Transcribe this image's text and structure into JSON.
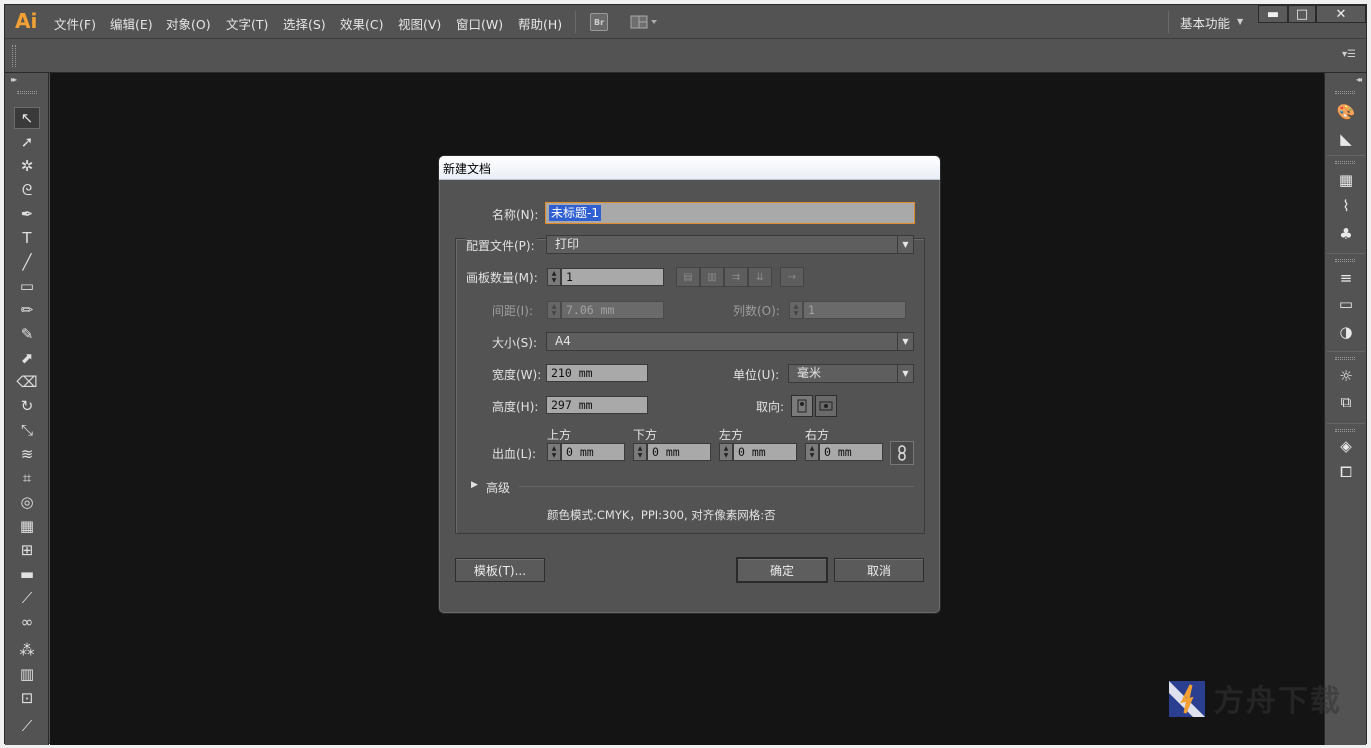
{
  "app": {
    "logo": "Ai",
    "menu": [
      "文件(F)",
      "编辑(E)",
      "对象(O)",
      "文字(T)",
      "选择(S)",
      "效果(C)",
      "视图(V)",
      "窗口(W)",
      "帮助(H)"
    ],
    "bridge_label": "Br",
    "workspace": "基本功能",
    "window_controls": {
      "minimize": "▬",
      "maximize": "□",
      "close": "✕"
    }
  },
  "tools": [
    {
      "name": "selection-tool",
      "glyph": "↖"
    },
    {
      "name": "direct-selection-tool",
      "glyph": "➚"
    },
    {
      "name": "magic-wand-tool",
      "glyph": "✲"
    },
    {
      "name": "lasso-tool",
      "glyph": "ᘓ"
    },
    {
      "name": "pen-tool",
      "glyph": "✒"
    },
    {
      "name": "type-tool",
      "glyph": "T"
    },
    {
      "name": "line-tool",
      "glyph": "╱"
    },
    {
      "name": "rectangle-tool",
      "glyph": "▭"
    },
    {
      "name": "paintbrush-tool",
      "glyph": "✏"
    },
    {
      "name": "pencil-tool",
      "glyph": "✎"
    },
    {
      "name": "blob-brush-tool",
      "glyph": "⬈"
    },
    {
      "name": "eraser-tool",
      "glyph": "⌫"
    },
    {
      "name": "rotate-tool",
      "glyph": "↻"
    },
    {
      "name": "scale-tool",
      "glyph": "⤡"
    },
    {
      "name": "warp-tool",
      "glyph": "≋"
    },
    {
      "name": "free-transform-tool",
      "glyph": "⌗"
    },
    {
      "name": "shape-builder-tool",
      "glyph": "◎"
    },
    {
      "name": "perspective-grid-tool",
      "glyph": "▦"
    },
    {
      "name": "mesh-tool",
      "glyph": "⊞"
    },
    {
      "name": "gradient-tool",
      "glyph": "▬"
    },
    {
      "name": "eyedropper-tool",
      "glyph": "⟋"
    },
    {
      "name": "blend-tool",
      "glyph": "∞"
    },
    {
      "name": "symbol-sprayer-tool",
      "glyph": "⁂"
    },
    {
      "name": "column-graph-tool",
      "glyph": "▥"
    },
    {
      "name": "artboard-tool",
      "glyph": "⊡"
    },
    {
      "name": "slice-tool",
      "glyph": "⟋"
    }
  ],
  "dock_icons": [
    {
      "name": "color-icon",
      "glyph": "🎨"
    },
    {
      "name": "color-guide-icon",
      "glyph": "◣"
    },
    {
      "name": "swatches-icon",
      "glyph": "▦"
    },
    {
      "name": "brushes-icon",
      "glyph": "⌇"
    },
    {
      "name": "symbols-icon",
      "glyph": "♣"
    },
    {
      "name": "stroke-icon",
      "glyph": "≡"
    },
    {
      "name": "gradient-icon",
      "glyph": "▭"
    },
    {
      "name": "transparency-icon",
      "glyph": "◑"
    },
    {
      "name": "appearance-icon",
      "glyph": "☼"
    },
    {
      "name": "graphic-styles-icon",
      "glyph": "⧉"
    },
    {
      "name": "layers-icon",
      "glyph": "◈"
    },
    {
      "name": "artboards-icon",
      "glyph": "⧠"
    }
  ],
  "dialog": {
    "title": "新建文档",
    "name_label": "名称(N):",
    "name_value": "未标题-1",
    "profile_label": "配置文件(P):",
    "profile_value": "打印",
    "artboards_label": "画板数量(M):",
    "artboards_value": "1",
    "spacing_label": "间距(I):",
    "spacing_value": "7.06 mm",
    "columns_label": "列数(O):",
    "columns_value": "1",
    "size_label": "大小(S):",
    "size_value": "A4",
    "width_label": "宽度(W):",
    "width_value": "210 mm",
    "units_label": "单位(U):",
    "units_value": "毫米",
    "height_label": "高度(H):",
    "height_value": "297 mm",
    "orientation_label": "取向:",
    "bleed_label": "出血(L):",
    "bleed": {
      "top_label": "上方",
      "top_value": "0 mm",
      "bottom_label": "下方",
      "bottom_value": "0 mm",
      "left_label": "左方",
      "left_value": "0 mm",
      "right_label": "右方",
      "right_value": "0 mm"
    },
    "advanced_label": "高级",
    "summary": "颜色模式:CMYK，PPI:300, 对齐像素网格:否",
    "templates_button": "模板(T)...",
    "ok_button": "确定",
    "cancel_button": "取消"
  }
}
